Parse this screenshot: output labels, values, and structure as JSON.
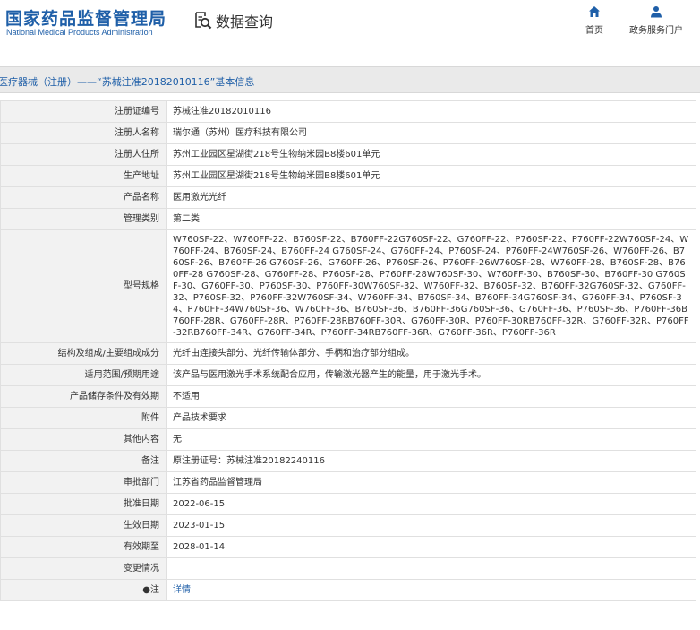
{
  "header": {
    "logo_cn": "国家药品监督管理局",
    "logo_en": "National Medical Products Administration",
    "query_label": "数据查询",
    "nav": [
      {
        "label": "首页",
        "icon": "home-icon"
      },
      {
        "label": "政务服务门户",
        "icon": "user-icon"
      }
    ]
  },
  "breadcrumb": "医疗器械（注册）——“苏械注准20182010116”基本信息",
  "fields": [
    {
      "label": "注册证编号",
      "value": "苏械注准20182010116"
    },
    {
      "label": "注册人名称",
      "value": "瑞尔通（苏州）医疗科技有限公司"
    },
    {
      "label": "注册人住所",
      "value": "苏州工业园区星湖街218号生物纳米园B8楼601单元"
    },
    {
      "label": "生产地址",
      "value": "苏州工业园区星湖街218号生物纳米园B8楼601单元"
    },
    {
      "label": "产品名称",
      "value": "医用激光光纤"
    },
    {
      "label": "管理类别",
      "value": "第二类"
    },
    {
      "label": "型号规格",
      "value": "W760SF-22、W760FF-22、B760SF-22、B760FF-22G760SF-22、G760FF-22、P760SF-22、P760FF-22W760SF-24、W760FF-24、B760SF-24、B760FF-24 G760SF-24、G760FF-24、P760SF-24、P760FF-24W760SF-26、W760FF-26、B760SF-26、B760FF-26 G760SF-26、G760FF-26、P760SF-26、P760FF-26W760SF-28、W760FF-28、B760SF-28、B760FF-28 G760SF-28、G760FF-28、P760SF-28、P760FF-28W760SF-30、W760FF-30、B760SF-30、B760FF-30 G760SF-30、G760FF-30、P760SF-30、P760FF-30W760SF-32、W760FF-32、B760SF-32、B760FF-32G760SF-32、G760FF-32、P760SF-32、P760FF-32W760SF-34、W760FF-34、B760SF-34、B760FF-34G760SF-34、G760FF-34、P760SF-34、P760FF-34W760SF-36、W760FF-36、B760SF-36、B760FF-36G760SF-36、G760FF-36、P760SF-36、P760FF-36B760FF-28R、G760FF-28R、P760FF-28RB760FF-30R、G760FF-30R、P760FF-30RB760FF-32R、G760FF-32R、P760FF-32RB760FF-34R、G760FF-34R、P760FF-34RB760FF-36R、G760FF-36R、P760FF-36R",
      "multi": true
    },
    {
      "label": "结构及组成/主要组成成分",
      "value": "光纤由连接头部分、光纤传输体部分、手柄和治疗部分组成。"
    },
    {
      "label": "适用范围/预期用途",
      "value": "该产品与医用激光手术系统配合应用，传输激光器产生的能量，用于激光手术。"
    },
    {
      "label": "产品储存条件及有效期",
      "value": "不适用"
    },
    {
      "label": "附件",
      "value": "产品技术要求"
    },
    {
      "label": "其他内容",
      "value": "无"
    },
    {
      "label": "备注",
      "value": "原注册证号：苏械注准20182240116"
    },
    {
      "label": "审批部门",
      "value": "江苏省药品监督管理局"
    },
    {
      "label": "批准日期",
      "value": "2022-06-15"
    },
    {
      "label": "生效日期",
      "value": "2023-01-15"
    },
    {
      "label": "有效期至",
      "value": "2028-01-14"
    },
    {
      "label": "变更情况",
      "value": ""
    },
    {
      "label": "●注",
      "value": "详情",
      "link": true
    }
  ],
  "colors": {
    "brand": "#1f5fa8",
    "label_bg": "#f2f2f2",
    "band_bg": "#eaeaea"
  }
}
